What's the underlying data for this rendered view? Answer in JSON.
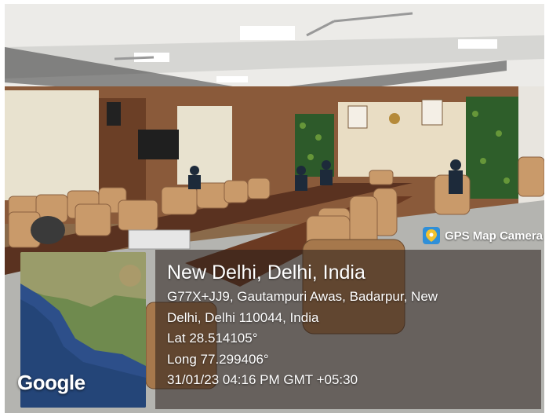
{
  "overlay": {
    "app_name": "GPS Map Camera",
    "city": "New Delhi, Delhi, India",
    "address_line1": "G77X+JJ9, Gautampuri Awas, Badarpur, New",
    "address_line2": "Delhi, Delhi 110044, India",
    "latitude": "Lat 28.514105°",
    "longitude": "Long 77.299406°",
    "timestamp": "31/01/23 04:16 PM GMT +05:30",
    "map_brand": "Google"
  },
  "colors": {
    "panel": "#281e19",
    "badge": "#2f8fd8",
    "wood_wall": "#8a5a3a",
    "ceiling": "#f2f2f0",
    "carpet": "#b4b4b0",
    "chairs": "#c99a6a"
  },
  "icons": [
    "map-pin-icon"
  ]
}
